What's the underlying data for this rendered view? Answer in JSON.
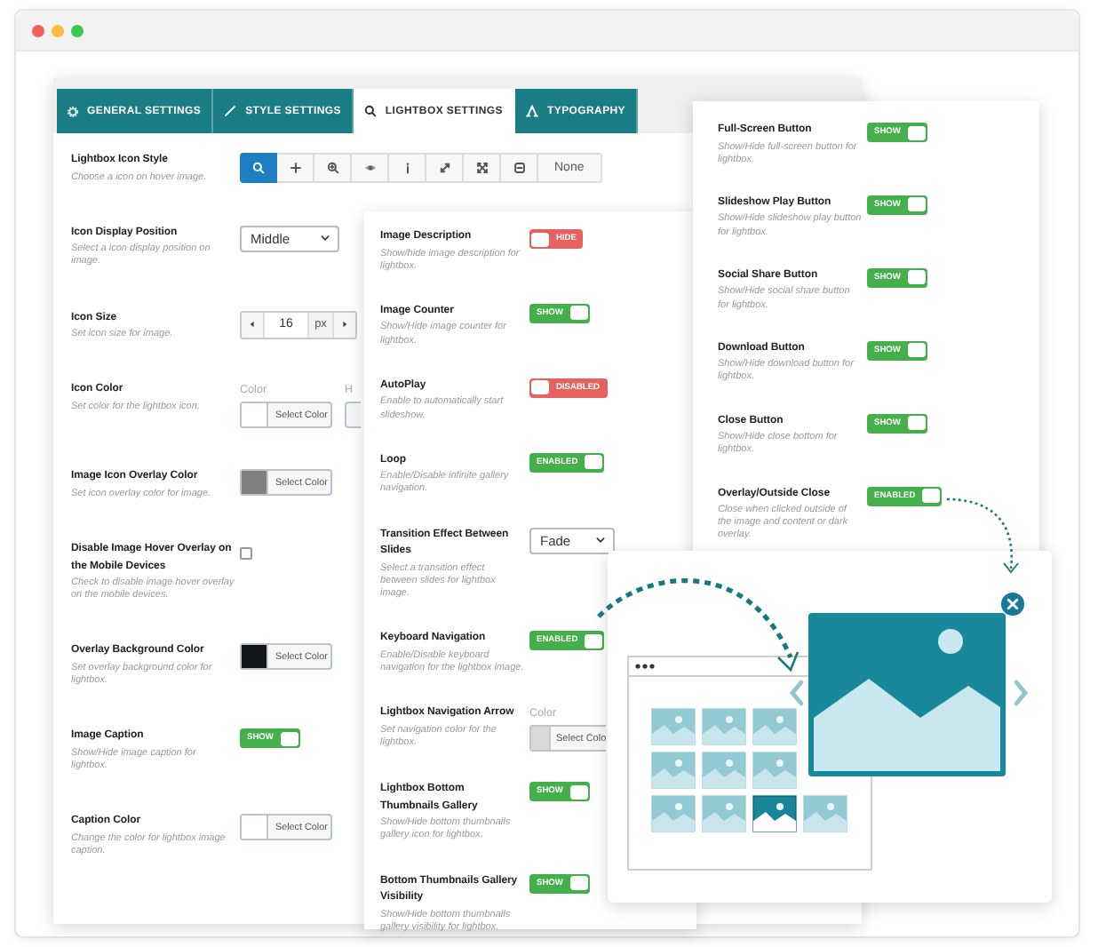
{
  "tabs": [
    {
      "label": "GENERAL SETTINGS",
      "selected": false
    },
    {
      "label": "STYLE SETTINGS",
      "selected": false
    },
    {
      "label": "LIGHTBOX SETTINGS",
      "selected": true
    },
    {
      "label": "TYPOGRAPHY",
      "selected": false
    }
  ],
  "settings_panel": {
    "rows": [
      {
        "kind": "icon_picker",
        "label": "Lightbox Icon Style",
        "description": "Choose a icon on hover image.",
        "options": [
          {
            "selected": true
          },
          {
            "selected": false
          },
          {
            "selected": false
          },
          {
            "selected": false
          },
          {
            "selected": false
          },
          {
            "selected": false
          },
          {
            "selected": false
          },
          {
            "selected": false
          },
          {
            "label": "None",
            "selected": false
          }
        ]
      },
      {
        "kind": "select",
        "label": "Icon Display Position",
        "description": "Select a icon display position on image.",
        "value": "Middle"
      },
      {
        "kind": "stepper",
        "label": "Icon Size",
        "description": "Set icon size for image.",
        "value": "16",
        "unit": "px"
      },
      {
        "kind": "color",
        "label": "Icon Color",
        "description": "Set color for the lightbox icon.",
        "field_label": "Color",
        "second_field_label": "H",
        "button": "Select Color",
        "color": "#ffffff"
      },
      {
        "kind": "color",
        "label": "Image Icon Overlay Color",
        "description": "Set icon overlay color for image.",
        "button": "Select Color",
        "color": "#808080"
      },
      {
        "kind": "checkbox",
        "label": "Disable Image Hover Overlay on the Mobile Devices",
        "description": "Check to disable image hover overlay on the mobile devices.",
        "checked": false
      },
      {
        "kind": "color",
        "label": "Overlay Background Color",
        "description": "Set overlay background color for lightbox.",
        "button": "Select Color",
        "color": "#111418"
      },
      {
        "kind": "toggle",
        "label": "Image Caption",
        "description": "Show/Hide image caption for lightbox.",
        "state": "SHOW",
        "on": true
      },
      {
        "kind": "color",
        "label": "Caption Color",
        "description": "Change the color for lightbox image caption.",
        "button": "Select Color",
        "color": "#ffffff"
      }
    ]
  },
  "lightbox_panel": {
    "rows": [
      {
        "kind": "toggle",
        "label": "Image Description",
        "description": "Show/hide image description for lightbox.",
        "state": "HIDE",
        "on": false
      },
      {
        "kind": "toggle",
        "label": "Image Counter",
        "description": "Show/Hide image counter for lightbox.",
        "state": "SHOW",
        "on": true
      },
      {
        "kind": "toggle",
        "label": "AutoPlay",
        "description": "Enable to automatically start slideshow.",
        "state": "DISABLED",
        "on": false
      },
      {
        "kind": "toggle",
        "label": "Loop",
        "description": "Enable/Disable infinite gallery navigation.",
        "state": "ENABLED",
        "on": true
      },
      {
        "kind": "select",
        "label": "Transition Effect Between Slides",
        "description": "Select a transition effect between slides for lightbox image.",
        "value": "Fade"
      },
      {
        "kind": "toggle",
        "label": "Keyboard Navigation",
        "description": "Enable/Disable keyboard navigation for the lightbox image.",
        "state": "ENABLED",
        "on": true
      },
      {
        "kind": "color",
        "label": "Lightbox Navigation Arrow",
        "description": "Set navigation color for the lightbox.",
        "field_label": "Color",
        "button": "Select Colo",
        "color": "#d9d9d9"
      },
      {
        "kind": "toggle",
        "label": "Lightbox Bottom Thumbnails Gallery",
        "description": "Show/Hide bottom thumbnails gallery icon for lightbox.",
        "state": "SHOW",
        "on": true
      },
      {
        "kind": "toggle",
        "label": "Bottom Thumbnails Gallery Visibility",
        "description": "Show/Hide bottom thumbnails gallery visibility for lightbox.",
        "state": "SHOW",
        "on": true
      }
    ]
  },
  "buttons_panel": {
    "rows": [
      {
        "kind": "toggle",
        "label": "Full-Screen Button",
        "description": "Show/Hide full-screen button for lightbox.",
        "state": "SHOW",
        "on": true
      },
      {
        "kind": "toggle",
        "label": "Slideshow Play Button",
        "description": "Show/Hide slideshow play button for lightbox.",
        "state": "SHOW",
        "on": true
      },
      {
        "kind": "toggle",
        "label": "Social Share Button",
        "description": "Show/Hide social share button for lightbox.",
        "state": "SHOW",
        "on": true
      },
      {
        "kind": "toggle",
        "label": "Download Button",
        "description": "Show/Hide download button for lightbox.",
        "state": "SHOW",
        "on": true
      },
      {
        "kind": "toggle",
        "label": "Close Button",
        "description": "Show/Hide close bottom for lightbox.",
        "state": "SHOW",
        "on": true
      },
      {
        "kind": "toggle",
        "label": "Overlay/Outside Close",
        "description": "Close when clicked outside of the image and content or dark overlay.",
        "state": "ENABLED",
        "on": true
      }
    ]
  },
  "preview": {
    "thumbnails": [
      {
        "selected": false
      },
      {
        "selected": false
      },
      {
        "selected": false
      },
      {
        "selected": false
      },
      {
        "selected": false
      },
      {
        "selected": false
      },
      {
        "selected": false
      },
      {
        "selected": false
      },
      {
        "selected": true
      },
      {
        "selected": false
      }
    ]
  }
}
